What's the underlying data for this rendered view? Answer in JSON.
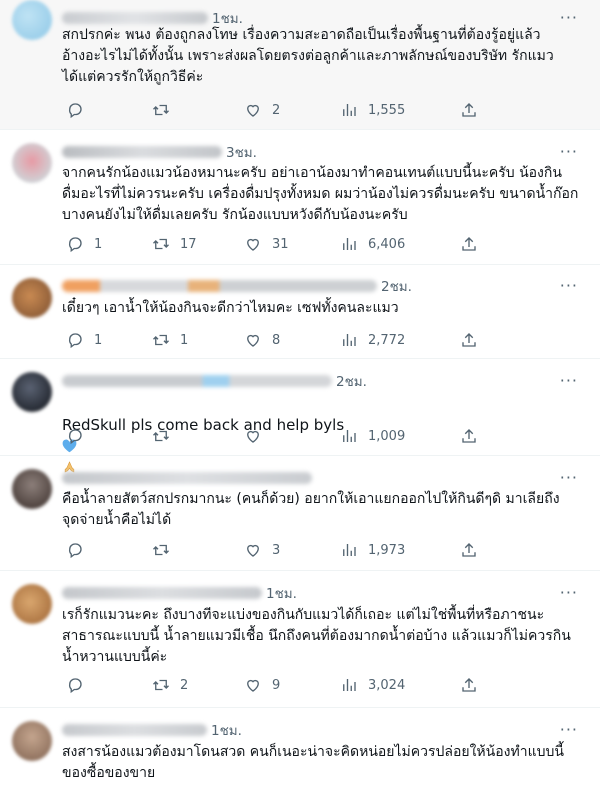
{
  "tweets": [
    {
      "time": "1ชม.",
      "text": "สกปรกค่ะ  พนง ต้องถูกลงโทษ เรื่องความสะอาดถือเป็นเรื่องพื้นฐานที่ต้องรู้อยู่แล้ว\nอ้างอะไรไม่ได้ทั้งนั้น เพราะส่งผลโดยตรงต่อลูกค้าและภาพลักษณ์ของบริษัท  รักแมว\nได้แต่ควรรักให้ถูกวิธีค่ะ",
      "replies": "",
      "retweets": "",
      "likes": "2",
      "views": "1,555"
    },
    {
      "time": "3ชม.",
      "text": "จากคนรักน้องแมวน้องหมานะครับ อย่าเอาน้องมาทำคอนเทนต์แบบนี้นะครับ น้องกิน\nดื่มอะไรที่ไม่ควรนะครับ เครื่องดื่มปรุงทั้งหมด ผมว่าน้องไม่ควรดื่มนะครับ ขนาดน้ำก๊อก\nบางคนยังไม่ให้ดื่มเลยครับ รักน้องแบบหวังดีกับน้องนะครับ",
      "replies": "1",
      "retweets": "17",
      "likes": "31",
      "views": "6,406"
    },
    {
      "time": "2ชม.",
      "text": "เดี๋ยวๆ เอาน้ำให้น้องกินจะดีกว่าไหมคะ เซฟทั้งคนละแมว",
      "replies": "1",
      "retweets": "1",
      "likes": "8",
      "views": "2,772"
    },
    {
      "time": "2ชม.",
      "text": "RedSkull pls come back and help byls",
      "replies": "",
      "retweets": "",
      "likes": "",
      "views": "1,009"
    },
    {
      "time": "",
      "text": "คือน้ำลายสัตว์สกปรกมากนะ (คนก็ด้วย) อยากให้เอาแยกออกไปให้กินดีๆดิ มาเลียถึง\nจุดจ่ายน้ำคือไม่ได้",
      "replies": "",
      "retweets": "",
      "likes": "3",
      "views": "1,973"
    },
    {
      "time": "1ชม.",
      "text": "เรก็รักแมวนะคะ ถึงบางทีจะแบ่งของกินกับแมวได้ก็เถอะ แต่ไม่ใช่พื้นที่หรือภาชนะ\nสาธารณะแบบนี้ น้ำลายแมวมีเชื้อ นึกถึงคนที่ต้องมากดน้ำต่อบ้าง แล้วแมวก็ไม่ควรกิน\nน้ำหวานแบบนี้ค่ะ",
      "replies": "",
      "retweets": "2",
      "likes": "9",
      "views": "3,024"
    },
    {
      "time": "1ชม.",
      "text": "สงสารน้องแมวต้องมาโดนสวด คนก็เนอะน่าจะคิดหน่อยไม่ควรปล่อยให้น้องทำแบบนี้\nของซื้อของขาย",
      "replies": "",
      "retweets": "",
      "likes": "",
      "views": ""
    }
  ],
  "colors": {
    "text": "#0f1419",
    "muted": "#536471",
    "divider": "#eff3f4",
    "heart_emoji": "#5dadec"
  },
  "icons": [
    "reply-icon",
    "retweet-icon",
    "like-icon",
    "views-icon",
    "share-icon",
    "more-icon",
    "blue-heart-emoji",
    "praying-hands-emoji"
  ]
}
